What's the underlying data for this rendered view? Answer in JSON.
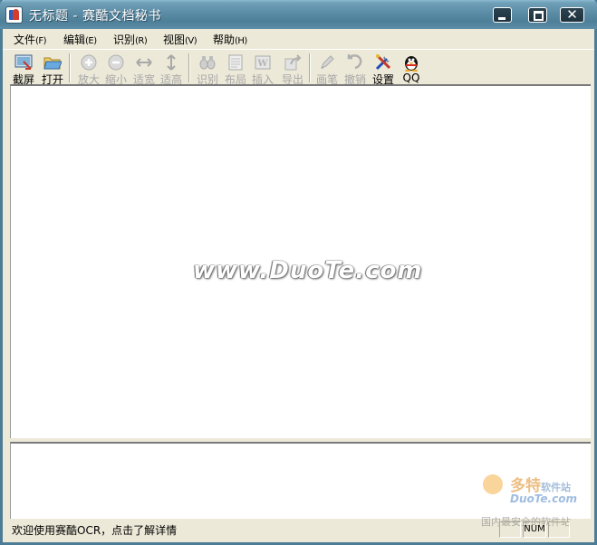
{
  "window": {
    "title": "无标题 - 赛酷文档秘书"
  },
  "caption_buttons": {
    "minimize": "▁",
    "maximize": "□",
    "close": "✕"
  },
  "menu": [
    {
      "label": "文件",
      "accel": "(F)"
    },
    {
      "label": "编辑",
      "accel": "(E)"
    },
    {
      "label": "识别",
      "accel": "(R)"
    },
    {
      "label": "视图",
      "accel": "(V)"
    },
    {
      "label": "帮助",
      "accel": "(H)"
    }
  ],
  "toolbar": [
    {
      "label": "截屏",
      "icon": "screenshot-icon",
      "enabled": true
    },
    {
      "label": "打开",
      "icon": "folder-open-icon",
      "enabled": true
    },
    {
      "label": "放大",
      "icon": "zoom-in-icon",
      "enabled": false
    },
    {
      "label": "缩小",
      "icon": "zoom-out-icon",
      "enabled": false
    },
    {
      "label": "适宽",
      "icon": "fit-width-icon",
      "enabled": false
    },
    {
      "label": "适高",
      "icon": "fit-height-icon",
      "enabled": false
    },
    {
      "label": "识别",
      "icon": "recognize-icon",
      "enabled": false
    },
    {
      "label": "布局",
      "icon": "layout-icon",
      "enabled": false
    },
    {
      "label": "插入",
      "icon": "insert-word-icon",
      "enabled": false
    },
    {
      "label": "导出",
      "icon": "export-icon",
      "enabled": false
    },
    {
      "label": "画笔",
      "icon": "pen-icon",
      "enabled": false
    },
    {
      "label": "撤销",
      "icon": "undo-icon",
      "enabled": false
    },
    {
      "label": "设置",
      "icon": "tools-icon",
      "enabled": true
    },
    {
      "label": "QQ",
      "icon": "qq-penguin-icon",
      "enabled": true
    }
  ],
  "watermark": {
    "text": "www.DuoTe.com"
  },
  "statusbar": {
    "message": "欢迎使用赛酷OCR，点击了解详情",
    "num": "NUM"
  },
  "corner_logo": {
    "brand": "多特",
    "sub": "软件站",
    "domain": "DuoTe.com",
    "slogan": "国内最安全的软件站"
  },
  "colors": {
    "title_bar": "#5B8CA5",
    "chrome": "#ECE9D8",
    "disabled_text": "#A7A7A7"
  }
}
